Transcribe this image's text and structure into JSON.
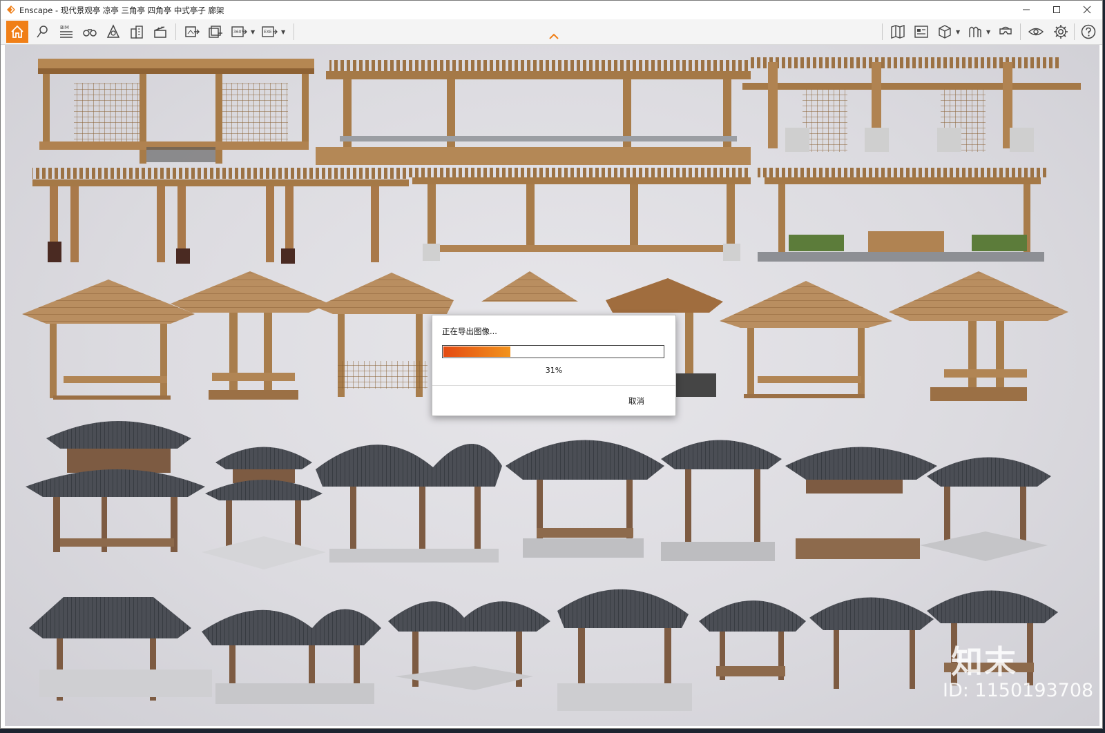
{
  "window": {
    "title": "Enscape - 现代景观亭 凉亭 三角亭 四角亭 中式亭子 廊架"
  },
  "toolbar": {
    "left_icons": [
      "home-icon",
      "location-pin-icon",
      "bim-icon",
      "binoculars-icon",
      "sun-icon",
      "building-icon",
      "clapperboard-icon",
      "screenshot-export-icon",
      "batch-render-icon",
      "panorama-360-icon",
      "exe-export-icon"
    ],
    "bim_label": "BIM",
    "pano_label": "360°",
    "exe_label": "EXE",
    "right_icons": [
      "map-icon",
      "materials-icon",
      "cube-icon",
      "asset-library-icon",
      "vr-headset-icon",
      "eye-icon",
      "gear-icon",
      "help-icon"
    ],
    "accent_color": "#f07f17"
  },
  "dialog": {
    "title": "正在导出图像...",
    "progress_fraction": 0.31,
    "progress_text": "31%",
    "cancel_label": "取消"
  },
  "watermark": {
    "logo": "知末",
    "id_text": "ID: 1150193708"
  }
}
